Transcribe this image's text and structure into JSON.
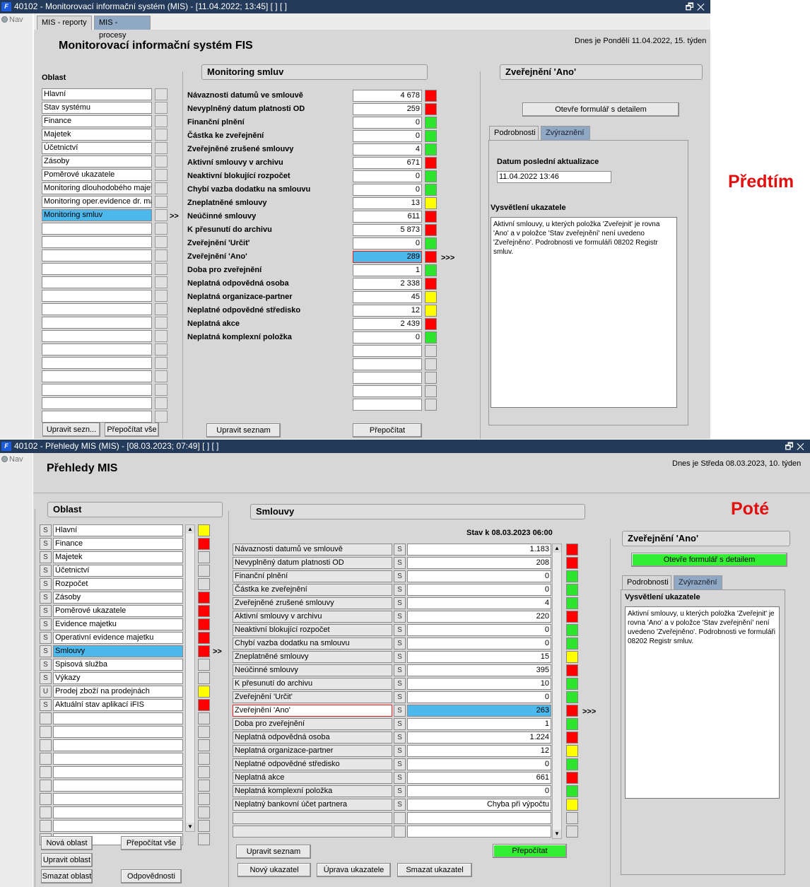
{
  "before": {
    "window_title": "40102 - Monitorovací informační systém (MIS) - [11.04.2022; 13:45]  [ ]  [ ]",
    "nav": "Nav",
    "tabs": [
      "MIS - reporty",
      "MIS - procesy"
    ],
    "heading": "Monitorovací informační systém FIS",
    "date": "Dnes je Pondělí 11.04.2022, 15. týden",
    "oblast_label": "Oblast",
    "oblast_items": [
      "Hlavní",
      "Stav systému",
      "Finance",
      "Majetek",
      "Účetnictví",
      "Zásoby",
      "Poměrové ukazatele",
      "Monitoring dlouhodobého majetku",
      "Monitoring oper.evidence dr. ma",
      "Monitoring smluv",
      "",
      "",
      "",
      "",
      "",
      "",
      "",
      "",
      "",
      "",
      "",
      "",
      "",
      "",
      ""
    ],
    "oblast_buttons": [
      "Upravit sezn...",
      "Přepočítat vše"
    ],
    "monitoring_title": "Monitoring smluv",
    "rows": [
      {
        "label": "Návaznosti datumů ve smlouvě",
        "value": "4 678",
        "color": "red"
      },
      {
        "label": "Nevyplněný datum platnosti OD",
        "value": "259",
        "color": "red"
      },
      {
        "label": "Finanční plnění",
        "value": "0",
        "color": "green"
      },
      {
        "label": "Částka ke zveřejnění",
        "value": "0",
        "color": "green"
      },
      {
        "label": "Zveřejněné zrušené smlouvy",
        "value": "4",
        "color": "green"
      },
      {
        "label": "Aktivní smlouvy v archivu",
        "value": "671",
        "color": "red"
      },
      {
        "label": "Neaktivní blokující rozpočet",
        "value": "0",
        "color": "green"
      },
      {
        "label": "Chybí vazba dodatku na smlouvu",
        "value": "0",
        "color": "green"
      },
      {
        "label": "Zneplatněné smlouvy",
        "value": "13",
        "color": "yellow"
      },
      {
        "label": "Neúčinné smlouvy",
        "value": "611",
        "color": "red"
      },
      {
        "label": "K přesunutí do archivu",
        "value": "5 873",
        "color": "red"
      },
      {
        "label": "Zveřejnění 'Určit'",
        "value": "0",
        "color": "green"
      },
      {
        "label": "Zveřejnění 'Ano'",
        "value": "289",
        "color": "red"
      },
      {
        "label": "Doba pro zveřejnění",
        "value": "1",
        "color": "green"
      },
      {
        "label": "Neplatná odpovědná osoba",
        "value": "2 338",
        "color": "red"
      },
      {
        "label": "Neplatná organizace-partner",
        "value": "45",
        "color": "yellow"
      },
      {
        "label": "Neplatné odpovědné středisko",
        "value": "12",
        "color": "yellow"
      },
      {
        "label": "Neplatná akce",
        "value": "2 439",
        "color": "red"
      },
      {
        "label": "Neplatná komplexní položka",
        "value": "0",
        "color": "green"
      },
      {
        "label": "",
        "value": "",
        "color": "gray"
      },
      {
        "label": "",
        "value": "",
        "color": "gray"
      },
      {
        "label": "",
        "value": "",
        "color": "gray"
      },
      {
        "label": "",
        "value": "",
        "color": "gray"
      },
      {
        "label": "",
        "value": "",
        "color": "gray"
      }
    ],
    "monitoring_buttons": [
      "Upravit seznam",
      "Přepočítat"
    ],
    "detail_title": "Zveřejnění 'Ano'",
    "open_form": "Otevře formulář s detailem",
    "detail_tabs": [
      "Podrobnosti",
      "Zvýraznění"
    ],
    "last_update_label": "Datum poslední aktualizace",
    "last_update_value": "11.04.2022 13:46",
    "explain_label": "Vysvětlení ukazatele",
    "explain_text": "Aktivní smlouvy, u kterých položka 'Zveřejnit' je rovna 'Ano' a v  položce 'Stav zveřejnění' není uvedeno 'Zveřejněno'.  Podrobnosti ve formuláři 08202 Registr smluv.",
    "arrows_a": ">>",
    "arrows_b": ">>>",
    "note": "Předtím"
  },
  "after": {
    "window_title": "40102 - Přehledy MIS (MIS) - [08.03.2023; 07:49]  [ ]  [ ]",
    "nav": "Nav",
    "heading": "Přehledy MIS",
    "date": "Dnes je Středa  08.03.2023, 10. týden",
    "oblast_title": "Oblast",
    "oblast_items": [
      {
        "flag": "S",
        "label": "Hlavní",
        "color": "yellow"
      },
      {
        "flag": "S",
        "label": "Finance",
        "color": "red"
      },
      {
        "flag": "S",
        "label": "Majetek",
        "color": "gray"
      },
      {
        "flag": "S",
        "label": "Účetnictví",
        "color": "gray"
      },
      {
        "flag": "S",
        "label": "Rozpočet",
        "color": "gray"
      },
      {
        "flag": "S",
        "label": "Zásoby",
        "color": "red"
      },
      {
        "flag": "S",
        "label": "Poměrové ukazatele",
        "color": "red"
      },
      {
        "flag": "S",
        "label": "Evidence majetku",
        "color": "red"
      },
      {
        "flag": "S",
        "label": "Operativní evidence majetku",
        "color": "red"
      },
      {
        "flag": "S",
        "label": "Smlouvy",
        "color": "red"
      },
      {
        "flag": "S",
        "label": "Spisová služba",
        "color": "gray"
      },
      {
        "flag": "S",
        "label": "Výkazy",
        "color": "gray"
      },
      {
        "flag": "U",
        "label": "Prodej zboží na prodejnách",
        "color": "yellow"
      },
      {
        "flag": "S",
        "label": "Aktuální stav aplikací iFIS",
        "color": "red"
      },
      {
        "flag": "",
        "label": "",
        "color": "gray"
      },
      {
        "flag": "",
        "label": "",
        "color": "gray"
      },
      {
        "flag": "",
        "label": "",
        "color": "gray"
      },
      {
        "flag": "",
        "label": "",
        "color": "gray"
      },
      {
        "flag": "",
        "label": "",
        "color": "gray"
      },
      {
        "flag": "",
        "label": "",
        "color": "gray"
      },
      {
        "flag": "",
        "label": "",
        "color": "gray"
      },
      {
        "flag": "",
        "label": "",
        "color": "gray"
      },
      {
        "flag": "",
        "label": "",
        "color": "gray"
      },
      {
        "flag": "",
        "label": "",
        "color": "gray"
      }
    ],
    "oblast_buttons": [
      "Nová oblast",
      "Přepočítat vše",
      "Upravit oblast",
      "Smazat oblast",
      "Odpovědnosti"
    ],
    "smlouvy_title": "Smlouvy",
    "stav": "Stav k 08.03.2023 06:00",
    "rows": [
      {
        "label": "Návaznosti datumů ve smlouvě",
        "flag": "S",
        "value": "1.183",
        "color": "red"
      },
      {
        "label": "Nevyplněný datum platnosti OD",
        "flag": "S",
        "value": "208",
        "color": "red"
      },
      {
        "label": "Finanční plnění",
        "flag": "S",
        "value": "0",
        "color": "green"
      },
      {
        "label": "Částka ke zveřejnění",
        "flag": "S",
        "value": "0",
        "color": "green"
      },
      {
        "label": "Zveřejněné zrušené smlouvy",
        "flag": "S",
        "value": "4",
        "color": "green"
      },
      {
        "label": "Aktivní smlouvy v archivu",
        "flag": "S",
        "value": "220",
        "color": "red"
      },
      {
        "label": "Neaktivní blokující rozpočet",
        "flag": "S",
        "value": "0",
        "color": "green"
      },
      {
        "label": "Chybí vazba dodatku na smlouvu",
        "flag": "S",
        "value": "0",
        "color": "green"
      },
      {
        "label": "Zneplatněné smlouvy",
        "flag": "S",
        "value": "15",
        "color": "yellow"
      },
      {
        "label": "Neúčinné smlouvy",
        "flag": "S",
        "value": "395",
        "color": "red"
      },
      {
        "label": "K přesunutí do archivu",
        "flag": "S",
        "value": "10",
        "color": "green"
      },
      {
        "label": "Zveřejnění 'Určit'",
        "flag": "S",
        "value": "0",
        "color": "green"
      },
      {
        "label": "Zveřejnění 'Ano'",
        "flag": "S",
        "value": "263",
        "color": "red"
      },
      {
        "label": "Doba pro zveřejnění",
        "flag": "S",
        "value": "1",
        "color": "green"
      },
      {
        "label": "Neplatná odpovědná osoba",
        "flag": "S",
        "value": "1.224",
        "color": "red"
      },
      {
        "label": "Neplatná organizace-partner",
        "flag": "S",
        "value": "12",
        "color": "yellow"
      },
      {
        "label": "Neplatné odpovědné středisko",
        "flag": "S",
        "value": "0",
        "color": "green"
      },
      {
        "label": "Neplatná akce",
        "flag": "S",
        "value": "661",
        "color": "red"
      },
      {
        "label": "Neplatná komplexní položka",
        "flag": "S",
        "value": "0",
        "color": "green"
      },
      {
        "label": "Neplatný bankovní účet partnera",
        "flag": "S",
        "value": "Chyba při výpočtu",
        "color": "yellow"
      },
      {
        "label": "",
        "flag": "",
        "value": "",
        "color": "gray"
      },
      {
        "label": "",
        "flag": "",
        "value": "",
        "color": "gray"
      }
    ],
    "smlouvy_buttons": [
      "Upravit seznam",
      "Přepočítat",
      "Nový ukazatel",
      "Úprava ukazatele",
      "Smazat ukazatel"
    ],
    "detail_title": "Zveřejnění 'Ano'",
    "open_form": "Otevře formulář s detailem",
    "detail_tabs": [
      "Podrobnosti",
      "Zvýraznění"
    ],
    "explain_label": "Vysvětlení ukazatele",
    "explain_text": "Aktivní smlouvy, u kterých položka 'Zveřejnit' je rovna 'Ano' a v  položce 'Stav zveřejnění' není uvedeno 'Zveřejněno'.  Podrobnosti ve formuláři 08202 Registr smluv.",
    "arrows_a": ">>",
    "arrows_b": ">>>",
    "note": "Poté"
  },
  "colors": {
    "red": "#ff0000",
    "green": "#2ee52e",
    "yellow": "#ffff00",
    "gray": "#dcdcdc",
    "title_bar": "#243a5a",
    "selection": "#4cb8ec"
  }
}
